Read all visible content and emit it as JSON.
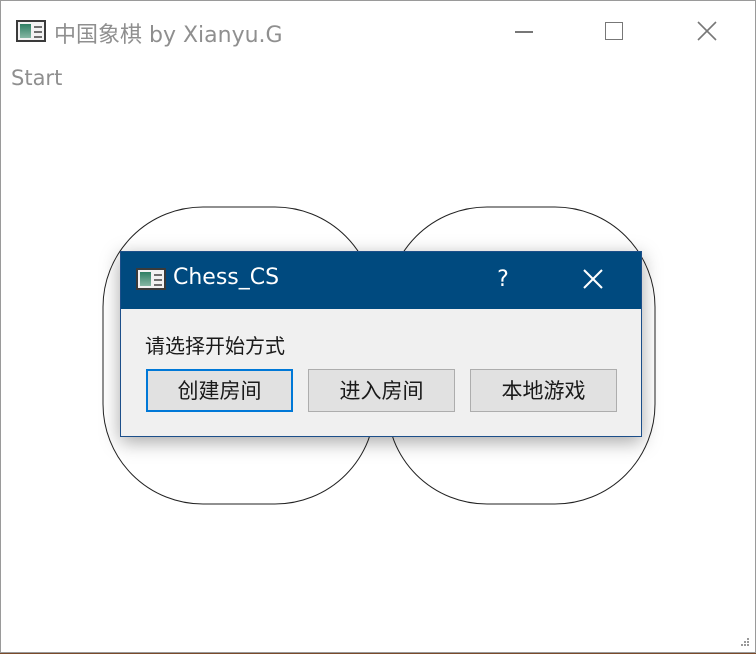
{
  "main_window": {
    "title": "中国象棋 by Xianyu.G",
    "menu": {
      "start_label": "Start"
    },
    "icons": {
      "app": "app-window-icon",
      "minimize": "minimize-icon",
      "maximize": "maximize-icon",
      "close": "close-icon",
      "resize": "resize-grip-icon"
    }
  },
  "dialog": {
    "title": "Chess_CS",
    "help_label": "?",
    "prompt": "请选择开始方式",
    "buttons": {
      "create_room": "创建房间",
      "join_room": "进入房间",
      "local_game": "本地游戏"
    },
    "icons": {
      "app": "app-window-icon",
      "close": "close-icon"
    }
  },
  "colors": {
    "dialog_titlebar": "#004a7f",
    "button_focus": "#0078d7",
    "button_face": "#e1e1e1",
    "window_bg": "#ffffff"
  }
}
